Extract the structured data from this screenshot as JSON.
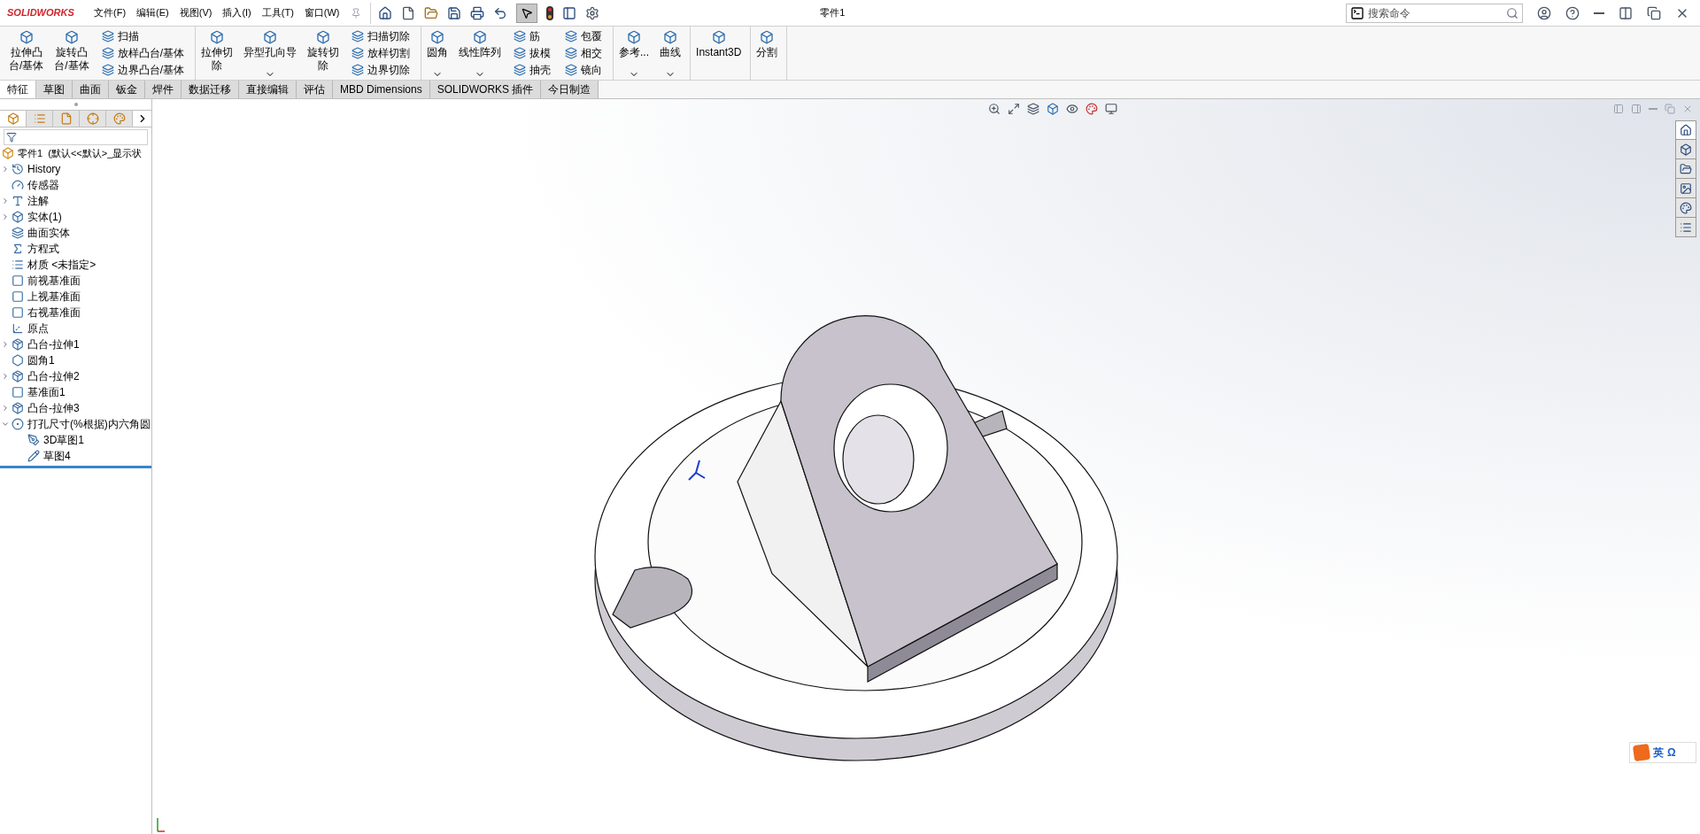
{
  "logo": {
    "text": "SOLIDWORKS"
  },
  "menu": [
    "文件(F)",
    "编辑(E)",
    "视图(V)",
    "插入(I)",
    "工具(T)",
    "窗口(W)"
  ],
  "title": "零件1",
  "search": {
    "placeholder": "搜索命令"
  },
  "ribbon": [
    {
      "columns": [
        {
          "kind": "large",
          "lines": [
            "拉伸凸",
            "台/基体"
          ],
          "dropdown": false
        },
        {
          "kind": "large",
          "lines": [
            "旋转凸",
            "台/基体"
          ],
          "dropdown": false
        },
        {
          "kind": "stack",
          "items": [
            "扫描",
            "放样凸台/基体",
            "边界凸台/基体"
          ]
        }
      ]
    },
    {
      "columns": [
        {
          "kind": "large",
          "lines": [
            "拉伸切",
            "除"
          ],
          "dropdown": false
        },
        {
          "kind": "large",
          "lines": [
            "异型孔向导"
          ],
          "dropdown": true
        },
        {
          "kind": "large",
          "lines": [
            "旋转切",
            "除"
          ],
          "dropdown": false
        },
        {
          "kind": "stack",
          "items": [
            "扫描切除",
            "放样切割",
            "边界切除"
          ]
        }
      ]
    },
    {
      "columns": [
        {
          "kind": "large",
          "lines": [
            "圆角"
          ],
          "dropdown": true
        },
        {
          "kind": "large",
          "lines": [
            "线性阵列"
          ],
          "dropdown": true
        },
        {
          "kind": "stack",
          "items": [
            "筋",
            "拔模",
            "抽壳"
          ]
        },
        {
          "kind": "stack",
          "items": [
            "包覆",
            "相交",
            "镜向"
          ]
        }
      ]
    },
    {
      "columns": [
        {
          "kind": "large",
          "lines": [
            "参考..."
          ],
          "dropdown": true
        },
        {
          "kind": "large",
          "lines": [
            "曲线"
          ],
          "dropdown": true
        }
      ]
    },
    {
      "columns": [
        {
          "kind": "large",
          "lines": [
            "Instant3D"
          ],
          "dropdown": false
        }
      ]
    },
    {
      "columns": [
        {
          "kind": "large",
          "lines": [
            "分割"
          ],
          "dropdown": false
        }
      ]
    }
  ],
  "tabs": [
    {
      "label": "特征",
      "selected": true
    },
    {
      "label": "草图",
      "selected": false
    },
    {
      "label": "曲面",
      "selected": false
    },
    {
      "label": "钣金",
      "selected": false
    },
    {
      "label": "焊件",
      "selected": false
    },
    {
      "label": "数据迁移",
      "selected": false
    },
    {
      "label": "直接编辑",
      "selected": false
    },
    {
      "label": "评估",
      "selected": false
    },
    {
      "label": "MBD Dimensions",
      "selected": false
    },
    {
      "label": "SOLIDWORKS 插件",
      "selected": false
    },
    {
      "label": "今日制造",
      "selected": false
    }
  ],
  "panel_tabs": [
    {
      "kind": "feature",
      "selected": true
    },
    {
      "kind": "property",
      "selected": false
    },
    {
      "kind": "config",
      "selected": false
    },
    {
      "kind": "dimxpert",
      "selected": false
    },
    {
      "kind": "display",
      "selected": false
    }
  ],
  "tree": {
    "root": "零件1  (默认<<默认>_显示状",
    "items": [
      {
        "label": "History",
        "kind": "history",
        "expandable": true,
        "expanded": false
      },
      {
        "label": "传感器",
        "kind": "sensor",
        "expandable": false
      },
      {
        "label": "注解",
        "kind": "annotation",
        "expandable": true,
        "expanded": false
      },
      {
        "label": "实体(1)",
        "kind": "solid",
        "expandable": true,
        "expanded": false
      },
      {
        "label": "曲面实体",
        "kind": "surface",
        "expandable": false
      },
      {
        "label": "方程式",
        "kind": "equation",
        "expandable": false
      },
      {
        "label": "材质 <未指定>",
        "kind": "material",
        "expandable": false
      },
      {
        "label": "前视基准面",
        "kind": "plane",
        "expandable": false
      },
      {
        "label": "上视基准面",
        "kind": "plane",
        "expandable": false
      },
      {
        "label": "右视基准面",
        "kind": "plane",
        "expandable": false
      },
      {
        "label": "原点",
        "kind": "origin",
        "expandable": false
      },
      {
        "label": "凸台-拉伸1",
        "kind": "extrude",
        "expandable": true,
        "expanded": false
      },
      {
        "label": "圆角1",
        "kind": "fillet",
        "expandable": false
      },
      {
        "label": "凸台-拉伸2",
        "kind": "extrude",
        "expandable": true,
        "expanded": false
      },
      {
        "label": "基准面1",
        "kind": "plane",
        "expandable": false
      },
      {
        "label": "凸台-拉伸3",
        "kind": "extrude",
        "expandable": true,
        "expanded": false
      },
      {
        "label": "打孔尺寸(%根据)内六角圆",
        "kind": "hole",
        "expandable": true,
        "expanded": true,
        "children": [
          {
            "label": "3D草图1",
            "kind": "sketch3d",
            "expandable": false
          },
          {
            "label": "草图4",
            "kind": "sketch",
            "expandable": false
          }
        ]
      }
    ]
  },
  "ime": {
    "language": "英",
    "symbol": "Ω"
  }
}
